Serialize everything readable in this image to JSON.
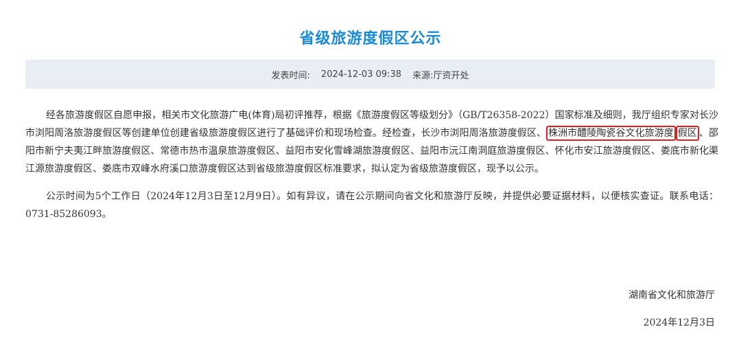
{
  "article": {
    "title": "省级旅游度假区公示",
    "meta": {
      "publish_label": "发表时间:",
      "publish_time": "2024-12-03 09:38",
      "source": "来源:厅资开处"
    },
    "paragraph1": {
      "before": "经各旅游度假区自愿申报，相关市文化旅游广电(体育)局初评推荐，根据《旅游度假区等级划分》（GB/T26358-2022）国家标准及细则，我厅组织专家对长沙市浏阳周洛旅游度假区等创建单位创建省级旅游度假区进行了基础评价和现场检查。经检查，长沙市浏阳周洛旅游度假区、",
      "highlight_1": "株洲市醴陵陶瓷谷文化旅游度",
      "highlight_2": "假区",
      "after": "、邵阳市新宁夫夷江畔旅游度假区、常德市热市温泉旅游度假区、益阳市安化雪峰湖旅游度假区、益阳市沅江南洞庭旅游度假区、怀化市安江旅游度假区、娄底市新化渠江源旅游度假区、娄底市双峰水府溪口旅游度假区达到省级旅游度假区标准要求，拟认定为省级旅游度假区，现予以公示。"
    },
    "paragraph2": "公示时间为5个工作日（2024年12月3日至12月9日）。如有异议，请在公示期间向省文化和旅游厅反映，并提供必要证据材料，以便核实查证。联系电话：0731-85286093。",
    "signature": {
      "org": "湖南省文化和旅游厅",
      "date": "2024年12月3日"
    }
  },
  "colors": {
    "title": "#1a8ad6",
    "meta_background": "#e9edf4",
    "highlight_border": "#e02020",
    "body_text": "#333333"
  }
}
